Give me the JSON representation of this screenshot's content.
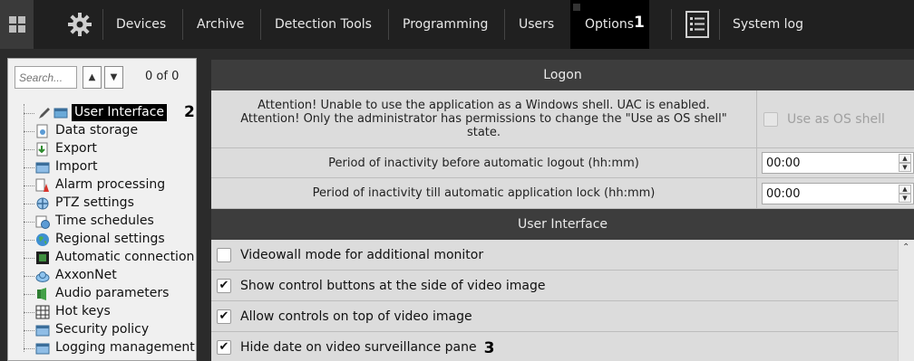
{
  "topbar": {
    "apps_icon": "apps-grid-icon",
    "settings_icon": "gear-icon",
    "tabs": [
      {
        "label": "Devices"
      },
      {
        "label": "Archive"
      },
      {
        "label": "Detection Tools"
      },
      {
        "label": "Programming"
      },
      {
        "label": "Users"
      },
      {
        "label": "Options"
      }
    ],
    "active_tab": "Options",
    "system_log_icon": "log-list-icon",
    "system_log_label": "System log"
  },
  "callouts": {
    "c1": "1",
    "c2": "2",
    "c3": "3"
  },
  "sidebar": {
    "search_placeholder": "Search...",
    "count_text": "0 of 0",
    "items": [
      {
        "label": "User Interface",
        "icon": "user-interface-icon",
        "selected": true
      },
      {
        "label": "Data storage",
        "icon": "data-storage-icon"
      },
      {
        "label": "Export",
        "icon": "export-icon"
      },
      {
        "label": "Import",
        "icon": "import-icon"
      },
      {
        "label": "Alarm processing",
        "icon": "alarm-icon"
      },
      {
        "label": "PTZ settings",
        "icon": "ptz-icon"
      },
      {
        "label": "Time schedules",
        "icon": "schedule-icon"
      },
      {
        "label": "Regional settings",
        "icon": "globe-icon"
      },
      {
        "label": "Automatic connection",
        "icon": "connection-icon"
      },
      {
        "label": "AxxonNet",
        "icon": "cloud-icon"
      },
      {
        "label": "Audio parameters",
        "icon": "audio-icon"
      },
      {
        "label": "Hot keys",
        "icon": "keyboard-icon"
      },
      {
        "label": "Security policy",
        "icon": "security-icon"
      },
      {
        "label": "Logging management",
        "icon": "logging-icon"
      }
    ]
  },
  "main": {
    "logon": {
      "header": "Logon",
      "warning_line1": "Attention! Unable to use the application as a Windows shell. UAC is enabled.",
      "warning_line2": "Attention! Only the administrator has permissions to change the \"Use as OS shell\"",
      "warning_line3": "state.",
      "os_shell_label": "Use as OS shell",
      "os_shell_checked": false,
      "logout_label": "Period of inactivity before automatic logout (hh:mm)",
      "logout_value": "00:00",
      "lock_label": "Period of inactivity till automatic application lock (hh:mm)",
      "lock_value": "00:00"
    },
    "ui": {
      "header": "User Interface",
      "options": [
        {
          "label": "Videowall mode for additional monitor",
          "checked": false
        },
        {
          "label": "Show control buttons at the side of video image",
          "checked": true
        },
        {
          "label": "Allow controls on top of video image",
          "checked": true
        },
        {
          "label": "Hide date on video surveillance pane",
          "checked": true
        }
      ]
    }
  },
  "colors": {
    "topbar_bg": "#202020",
    "active_tab_bg": "#000000",
    "section_header_bg": "#3d3d3d",
    "row_bg": "#dcdcdc",
    "selected_item_bg": "#000000"
  }
}
